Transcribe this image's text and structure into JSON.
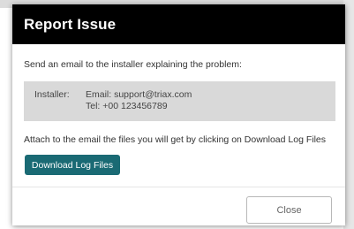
{
  "dialog": {
    "title": "Report Issue",
    "intro": "Send an email to the installer explaining the problem:",
    "installer": {
      "label": "Installer:",
      "email_line": "Email: support@triax.com",
      "tel_line": "Tel: +00 123456789"
    },
    "attach_text": "Attach to the email the files you will get by clicking on Download Log Files",
    "download_button_label": "Download Log Files",
    "close_button_label": "Close"
  },
  "colors": {
    "header_bg": "#000000",
    "accent": "#1a6a74",
    "info_box_bg": "#d9d9d9"
  }
}
